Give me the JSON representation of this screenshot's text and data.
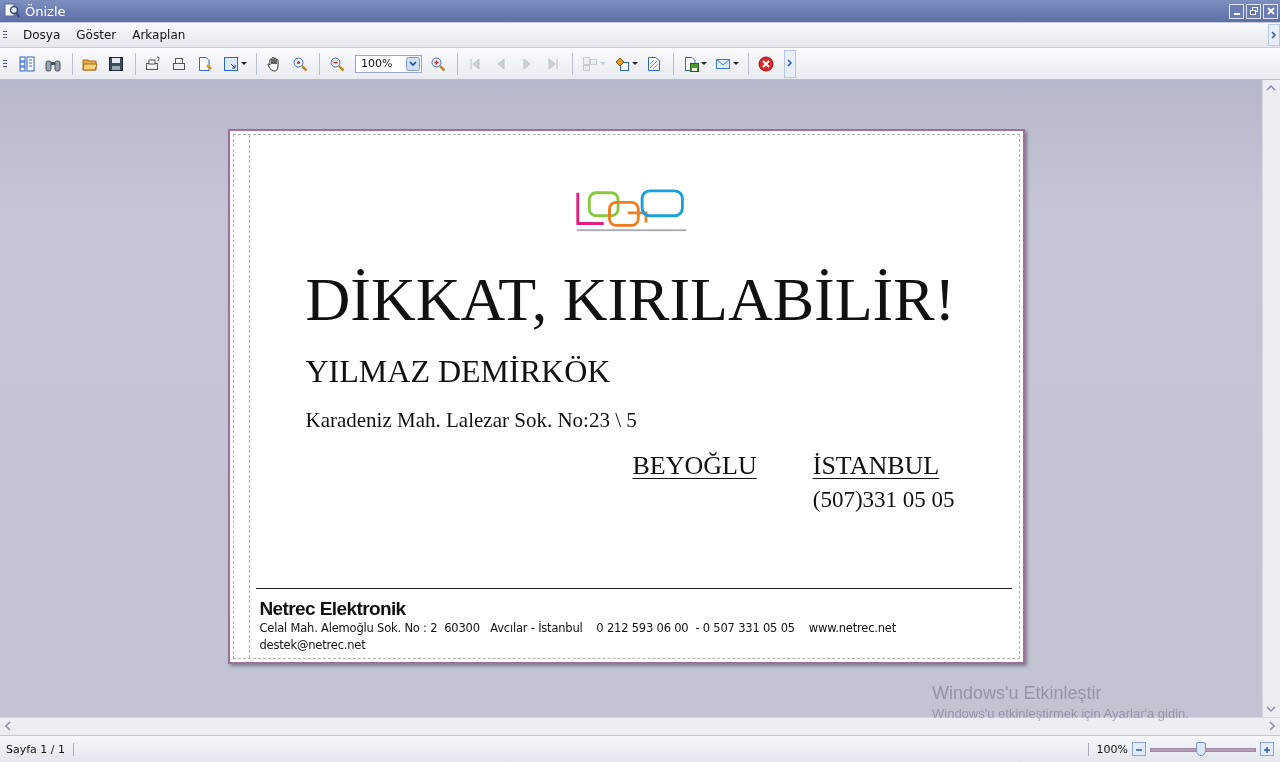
{
  "window": {
    "title": "Önizle"
  },
  "menu": [
    "Dosya",
    "Göster",
    "Arkaplan"
  ],
  "toolbar": [
    {
      "kind": "button",
      "disabled": false,
      "dropdown": false
    },
    {
      "kind": "button",
      "disabled": false,
      "dropdown": false
    },
    {
      "kind": "separator"
    },
    {
      "kind": "button",
      "disabled": false,
      "dropdown": false
    },
    {
      "kind": "button",
      "disabled": false,
      "dropdown": false
    },
    {
      "kind": "separator"
    },
    {
      "kind": "button",
      "disabled": false,
      "dropdown": false
    },
    {
      "kind": "button",
      "disabled": false,
      "dropdown": false
    },
    {
      "kind": "button",
      "disabled": false,
      "dropdown": false
    },
    {
      "kind": "button",
      "disabled": false,
      "dropdown": true
    },
    {
      "kind": "separator"
    },
    {
      "kind": "button",
      "disabled": false,
      "dropdown": false
    },
    {
      "kind": "button",
      "disabled": false,
      "dropdown": false
    },
    {
      "kind": "separator"
    },
    {
      "kind": "button",
      "disabled": false,
      "dropdown": false
    },
    {
      "kind": "zoom-field",
      "value": "100%"
    },
    {
      "kind": "button",
      "disabled": false,
      "dropdown": false
    },
    {
      "kind": "separator"
    },
    {
      "kind": "button",
      "disabled": true,
      "dropdown": false
    },
    {
      "kind": "button",
      "disabled": true,
      "dropdown": false
    },
    {
      "kind": "button",
      "disabled": true,
      "dropdown": false
    },
    {
      "kind": "button",
      "disabled": true,
      "dropdown": false
    },
    {
      "kind": "separator"
    },
    {
      "kind": "button",
      "disabled": true,
      "dropdown": true
    },
    {
      "kind": "button",
      "disabled": false,
      "dropdown": true
    },
    {
      "kind": "button",
      "disabled": false,
      "dropdown": false
    },
    {
      "kind": "separator"
    },
    {
      "kind": "button",
      "disabled": false,
      "dropdown": true
    },
    {
      "kind": "button",
      "disabled": false,
      "dropdown": true
    },
    {
      "kind": "separator"
    },
    {
      "kind": "button",
      "disabled": false,
      "dropdown": false
    }
  ],
  "document": {
    "heading": "DİKKAT, KIRILABİLİR!",
    "recipient": "YILMAZ DEMİRKÖK",
    "address": "Karadeniz Mah. Lalezar Sok. No:23 \\ 5",
    "district": "BEYOĞLU",
    "city": "İSTANBUL",
    "phone": "(507)331 05 05",
    "footer": {
      "company": "Netrec Elektronik",
      "details": "Celal Mah. Alemoğlu Sok. No : 2  60300   Avcılar - İstanbul    0 212 593 06 00  - 0 507 331 05 05    www.netrec.net",
      "email": "destek@netrec.net"
    }
  },
  "activation_notice": {
    "title": "Windows'u Etkinleştir",
    "message": "Windows'u etkinleştirmek için Ayarlar'a gidin."
  },
  "status_bar": {
    "page": "Sayfa 1 / 1",
    "zoom": "100%",
    "zoom_slider": {
      "level": 0.48
    }
  }
}
